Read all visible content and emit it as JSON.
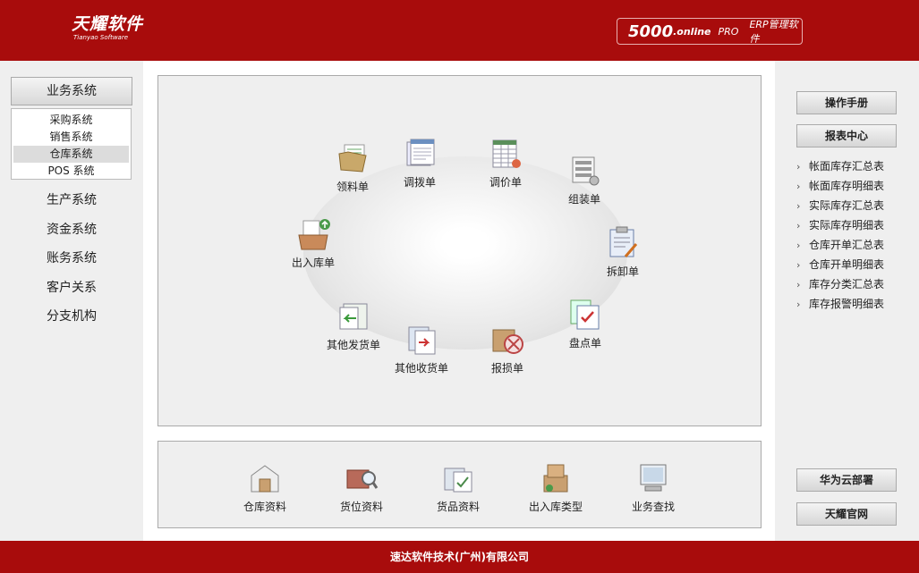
{
  "header": {
    "logo_cn": "天耀软件",
    "logo_en": "Tianyao Software",
    "product_num": "5000",
    "product_online": ".online",
    "product_pro": "PRO",
    "product_erp": "ERP管理软件"
  },
  "left_nav": {
    "header": "业务系统",
    "sub_items": [
      "采购系统",
      "销售系统",
      "仓库系统",
      "POS 系统"
    ],
    "active_sub": "仓库系统",
    "items": [
      "生产系统",
      "资金系统",
      "账务系统",
      "客户关系",
      "分支机构"
    ]
  },
  "ring_items": [
    {
      "label": "领料单",
      "icon": "folder-docs-icon"
    },
    {
      "label": "调拨单",
      "icon": "document-stack-icon"
    },
    {
      "label": "调价单",
      "icon": "price-sheet-icon"
    },
    {
      "label": "组装单",
      "icon": "assembly-icon"
    },
    {
      "label": "拆卸单",
      "icon": "clipboard-wrench-icon"
    },
    {
      "label": "盘点单",
      "icon": "checklist-icon"
    },
    {
      "label": "报损单",
      "icon": "box-cross-icon"
    },
    {
      "label": "其他收货单",
      "icon": "receive-docs-icon"
    },
    {
      "label": "其他发货单",
      "icon": "send-docs-icon"
    },
    {
      "label": "出入库单",
      "icon": "inbox-tray-icon"
    }
  ],
  "bottom_items": [
    {
      "label": "仓库资料",
      "icon": "warehouse-icon"
    },
    {
      "label": "货位资料",
      "icon": "location-search-icon"
    },
    {
      "label": "货品资料",
      "icon": "goods-box-icon"
    },
    {
      "label": "出入库类型",
      "icon": "boxes-icon"
    },
    {
      "label": "业务查找",
      "icon": "computer-search-icon"
    }
  ],
  "right": {
    "manual_btn": "操作手册",
    "report_btn": "报表中心",
    "reports": [
      "帐面库存汇总表",
      "帐面库存明细表",
      "实际库存汇总表",
      "实际库存明细表",
      "仓库开单汇总表",
      "仓库开单明细表",
      "库存分类汇总表",
      "库存报警明细表"
    ],
    "huawei_btn": "华为云部署",
    "official_btn": "天耀官网"
  },
  "footer": {
    "text": "速达软件技术(广州)有限公司"
  },
  "colors": {
    "brand_red": "#a80c0c",
    "panel_bg": "#efefef"
  }
}
